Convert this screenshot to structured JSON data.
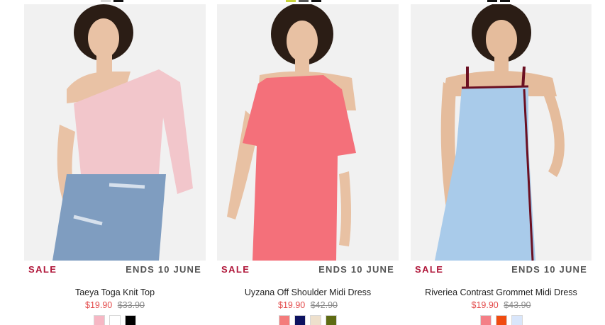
{
  "top_swatches": [
    {
      "colors": [
        "#d9d9d9",
        "#111111"
      ]
    },
    {
      "colors": [
        "#c9d33a",
        "#555555",
        "#111111"
      ]
    },
    {
      "colors": [
        "#111111",
        "#111111"
      ]
    }
  ],
  "products": [
    {
      "sale_label": "SALE",
      "ends_label": "ENDS 10 JUNE",
      "name": "Taeya Toga Knit Top",
      "price_now": "$19.90",
      "price_was": "$33.90",
      "garment_color": "#f2c6cb",
      "swatch_colors": [
        "#f6b7c4",
        "#ffffff",
        "#000000"
      ]
    },
    {
      "sale_label": "SALE",
      "ends_label": "ENDS 10 JUNE",
      "name": "Uyzana Off Shoulder Midi Dress",
      "price_now": "$19.90",
      "price_was": "$42.90",
      "garment_color": "#f4707a",
      "swatch_colors": [
        "#f47b7b",
        "#0d1260",
        "#eee0cc",
        "#5e6b13"
      ]
    },
    {
      "sale_label": "SALE",
      "ends_label": "ENDS 10 JUNE",
      "name": "Riveriea Contrast Grommet Midi Dress",
      "price_now": "$19.90",
      "price_was": "$43.90",
      "garment_color": "#a9cbea",
      "swatch_colors": [
        "#f47f86",
        "#f04b10",
        "#d9e6fb"
      ]
    }
  ]
}
